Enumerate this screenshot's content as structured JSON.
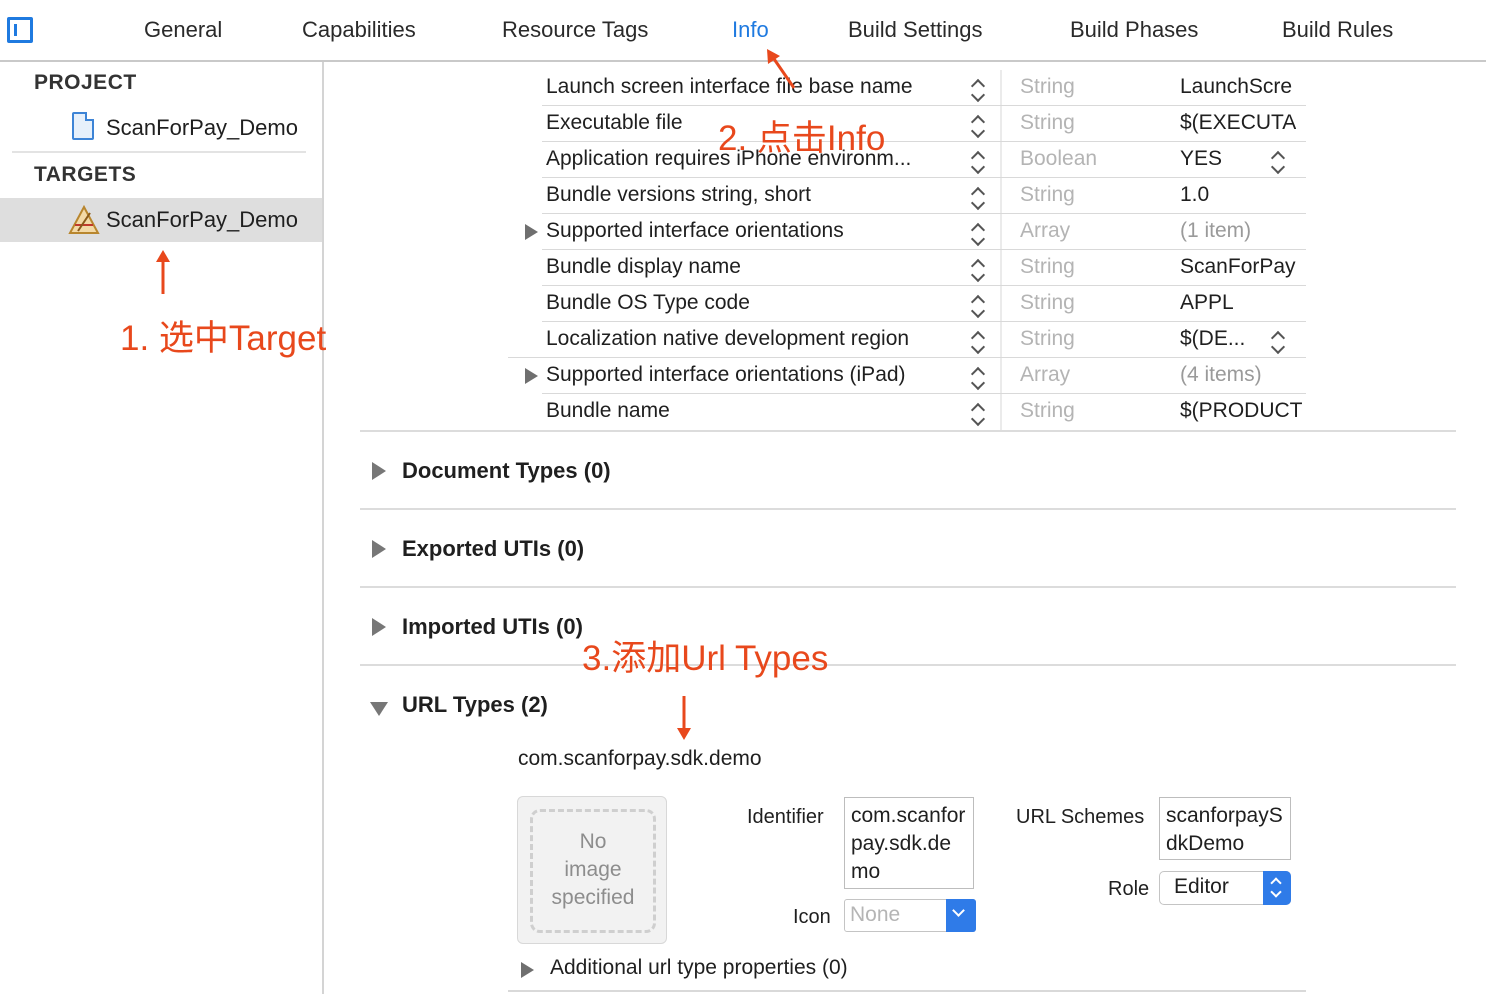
{
  "tabs": [
    {
      "label": "General",
      "active": false
    },
    {
      "label": "Capabilities",
      "active": false
    },
    {
      "label": "Resource Tags",
      "active": false
    },
    {
      "label": "Info",
      "active": true
    },
    {
      "label": "Build Settings",
      "active": false
    },
    {
      "label": "Build Phases",
      "active": false
    },
    {
      "label": "Build Rules",
      "active": false
    }
  ],
  "sidebar": {
    "project_header": "PROJECT",
    "project_item": "ScanForPay_Demo",
    "targets_header": "TARGETS",
    "target_item": "ScanForPay_Demo"
  },
  "plist_rows": [
    {
      "key": "Launch screen interface file base name",
      "type": "String",
      "value": "LaunchScre",
      "expandable": false,
      "value_stepper": false
    },
    {
      "key": "Executable file",
      "type": "String",
      "value": "$(EXECUTA",
      "expandable": false,
      "value_stepper": false
    },
    {
      "key": "Application requires iPhone environm...",
      "type": "Boolean",
      "value": "YES",
      "expandable": false,
      "value_stepper": true
    },
    {
      "key": "Bundle versions string, short",
      "type": "String",
      "value": "1.0",
      "expandable": false,
      "value_stepper": false
    },
    {
      "key": "Supported interface orientations",
      "type": "Array",
      "value": "(1 item)",
      "expandable": true,
      "value_stepper": false
    },
    {
      "key": "Bundle display name",
      "type": "String",
      "value": "ScanForPay",
      "expandable": false,
      "value_stepper": false
    },
    {
      "key": "Bundle OS Type code",
      "type": "String",
      "value": "APPL",
      "expandable": false,
      "value_stepper": false
    },
    {
      "key": "Localization native development region",
      "type": "String",
      "value": "$(DE...",
      "expandable": false,
      "value_stepper": true
    },
    {
      "key": "Supported interface orientations (iPad)",
      "type": "Array",
      "value": "(4 items)",
      "expandable": true,
      "value_stepper": false
    },
    {
      "key": "Bundle name",
      "type": "String",
      "value": "$(PRODUCT",
      "expandable": false,
      "value_stepper": false
    }
  ],
  "sections": [
    {
      "title": "Document Types (0)",
      "expanded": false
    },
    {
      "title": "Exported UTIs (0)",
      "expanded": false
    },
    {
      "title": "Imported UTIs (0)",
      "expanded": false
    },
    {
      "title": "URL Types (2)",
      "expanded": true
    }
  ],
  "url_type": {
    "name": "com.scanforpay.sdk.demo",
    "image_well": [
      "No",
      "image",
      "specified"
    ],
    "identifier_label": "Identifier",
    "identifier_value": "com.scanforpay.sdk.demo",
    "icon_label": "Icon",
    "icon_placeholder": "None",
    "url_schemes_label": "URL Schemes",
    "url_schemes_value": "scanforpaySdkDemo",
    "role_label": "Role",
    "role_value": "Editor",
    "additional_props": "Additional url type properties (0)"
  },
  "annotations": {
    "step1": "1. 选中Target",
    "step2": "2. 点击Info",
    "step3": "3.添加Url Types",
    "color": "#e8481c"
  },
  "colors": {
    "accent": "#1f7ae0",
    "popup_blue": "#2f7be8",
    "selection": "#dedede"
  }
}
